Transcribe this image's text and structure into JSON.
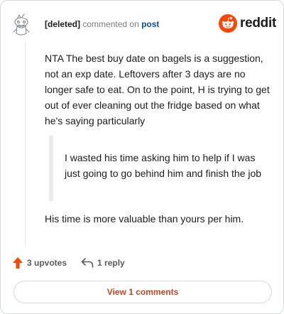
{
  "header": {
    "author": "[deleted]",
    "meta_text": "commented on",
    "post_link": "post"
  },
  "brand": {
    "name": "reddit",
    "color": "#ff4500"
  },
  "comment": {
    "paragraph_1": "NTA The best buy date on bagels is a suggestion, not an exp date. Leftovers after 3 days are no longer safe to eat. On to the point, H is trying to get out of ever cleaning out the fridge based on what he's saying particularly",
    "quote": "I wasted his time asking him to help if I was just going to go behind him and finish the job",
    "paragraph_2": "His time is more valuable than yours per him."
  },
  "actions": {
    "upvotes": "3 upvotes",
    "replies": "1 reply",
    "upvote_color": "#ff4500"
  },
  "view_button": {
    "label": "View 1 comments",
    "color": "#c6441f"
  },
  "icons": [
    "deleted-user-avatar-icon",
    "reddit-logo-icon",
    "upvote-arrow-icon",
    "reply-arrow-icon"
  ]
}
